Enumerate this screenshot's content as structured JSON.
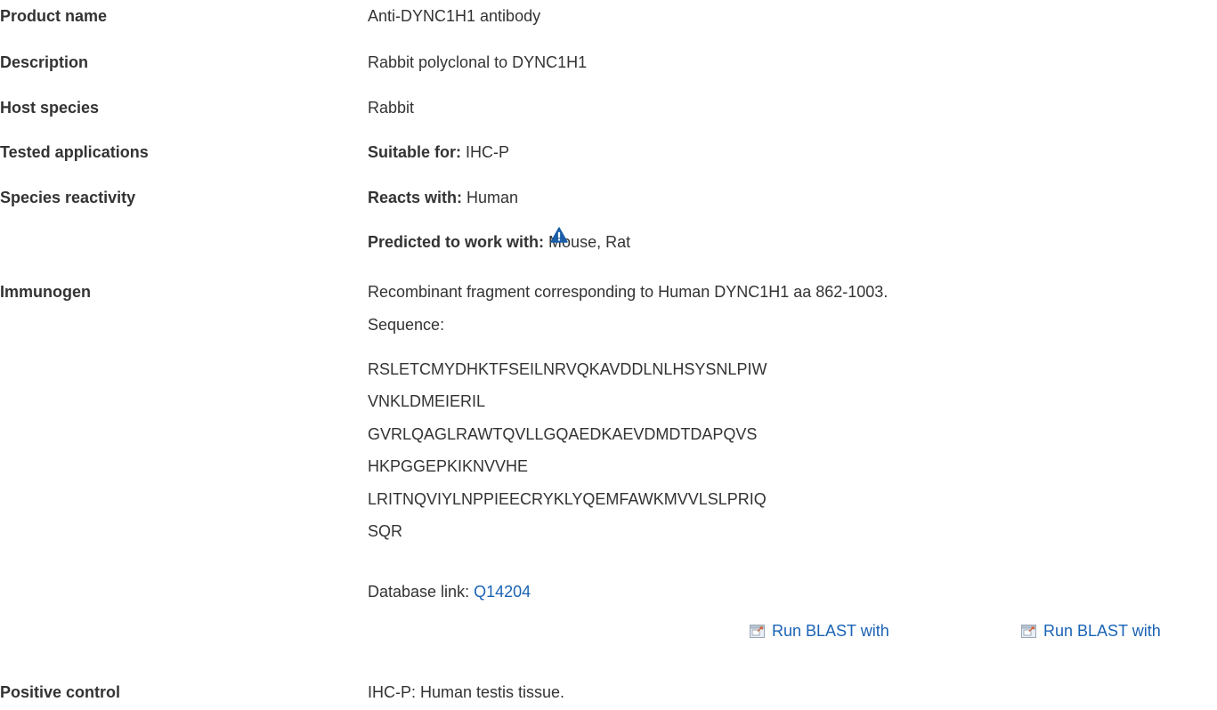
{
  "rows": {
    "product_name": {
      "label": "Product name",
      "value": "Anti-DYNC1H1 antibody"
    },
    "description": {
      "label": "Description",
      "value": "Rabbit polyclonal to DYNC1H1"
    },
    "host_species": {
      "label": "Host species",
      "value": "Rabbit"
    },
    "tested_applications": {
      "label": "Tested applications",
      "prefix": "Suitable for:",
      "value": "IHC-P"
    },
    "species_reactivity": {
      "label": "Species reactivity",
      "reacts_prefix": "Reacts with:",
      "reacts_value": "Human",
      "predicted_prefix": "Predicted to work with:",
      "predicted_value": "Mouse, Rat",
      "warning_icon": "warning-triangle-icon"
    },
    "immunogen": {
      "label": "Immunogen",
      "text": "Recombinant fragment corresponding to Human DYNC1H1 aa 862-1003.",
      "sequence_label": "Sequence:",
      "sequence_lines": [
        "RSLETCMYDHKTFSEILNRVQKAVDDLNLHSYSNLPIW",
        "VNKLDMEIERIL",
        "GVRLQAGLRAWTQVLLGQAEDKAEVDMDTDAPQVS",
        "HKPGGEPKIKNVVHE",
        "LRITNQVIYLNPPIEECRYKLYQEMFAWKMVVLSLPRIQ",
        "SQR"
      ],
      "database_prefix": "Database link:",
      "database_link": "Q14204",
      "blast_links": [
        "Run BLAST with",
        "Run BLAST with"
      ],
      "blast_icon": "external-window-icon"
    },
    "positive_control": {
      "label": "Positive control",
      "value": "IHC-P: Human testis tissue."
    }
  },
  "colors": {
    "text": "#333333",
    "link": "#1a63b4",
    "warning_icon": "#1a5fa8"
  }
}
